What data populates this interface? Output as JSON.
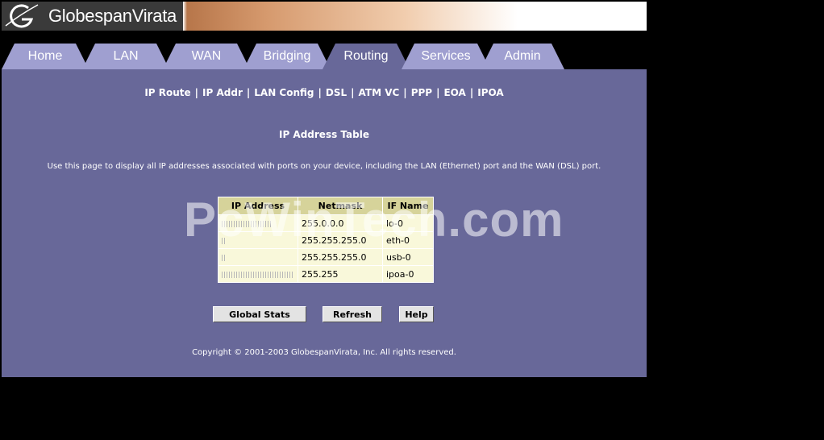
{
  "brand": {
    "name": "GlobespanVirata"
  },
  "tabs": [
    {
      "label": "Home"
    },
    {
      "label": "LAN"
    },
    {
      "label": "WAN"
    },
    {
      "label": "Bridging"
    },
    {
      "label": "Routing",
      "active": true
    },
    {
      "label": "Services"
    },
    {
      "label": "Admin"
    }
  ],
  "subnav": [
    "IP Route",
    "IP Addr",
    "LAN Config",
    "DSL",
    "ATM VC",
    "PPP",
    "EOA",
    "IPOA"
  ],
  "page": {
    "title": "IP Address Table",
    "description": "Use this page to display all IP addresses associated with ports on your device, including the LAN (Ethernet) port and the WAN (DSL) port."
  },
  "table": {
    "headers": [
      "IP Address",
      "Netmask",
      "IF Name"
    ],
    "rows": [
      {
        "ip": "",
        "netmask": "255.0.0.0",
        "ifname": "lo-0"
      },
      {
        "ip": "",
        "netmask": "255.255.255.0",
        "ifname": "eth-0"
      },
      {
        "ip": "",
        "netmask": "255.255.255.0",
        "ifname": "usb-0"
      },
      {
        "ip": "",
        "netmask": "255.255",
        "ifname": "ipoa-0"
      }
    ]
  },
  "buttons": {
    "global_stats": "Global Stats",
    "refresh": "Refresh",
    "help": "Help"
  },
  "copyright": "Copyright © 2001-2003 GlobespanVirata, Inc. All rights reserved.",
  "watermark": "PcWinTech.com",
  "colors": {
    "panel": "#686899",
    "tab": "#9f9fd0",
    "table_header": "#d6d39a",
    "table_cell": "#f9f8da"
  }
}
